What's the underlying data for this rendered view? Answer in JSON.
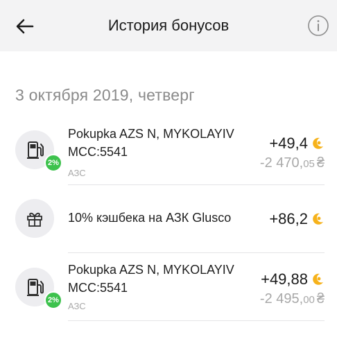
{
  "header": {
    "title": "История бонусов",
    "back_icon": "arrow-left-icon",
    "info_icon": "info-icon"
  },
  "date_heading": "3 октября 2019, четверг",
  "colors": {
    "badge": "#3dc24d",
    "coin": "#f6b21b",
    "muted": "#a8a8a8"
  },
  "transactions": [
    {
      "title": "Pokupka AZS N, MYKOLAYIV\nMCC:5541",
      "category": "АЗС",
      "icon": "fuel-pump-icon",
      "badge": "2%",
      "bonus": "+49,4",
      "amount_main": "-2 470,",
      "amount_dec": "05",
      "currency": "₴"
    },
    {
      "title": "10% кэшбека на АЗК Glusco",
      "icon": "gift-icon",
      "bonus": "+86,2"
    },
    {
      "title": "Pokupka AZS N, MYKOLAYIV\nMCC:5541",
      "category": "АЗС",
      "icon": "fuel-pump-icon",
      "badge": "2%",
      "bonus": "+49,88",
      "amount_main": "-2 495,",
      "amount_dec": "00",
      "currency": "₴"
    }
  ]
}
